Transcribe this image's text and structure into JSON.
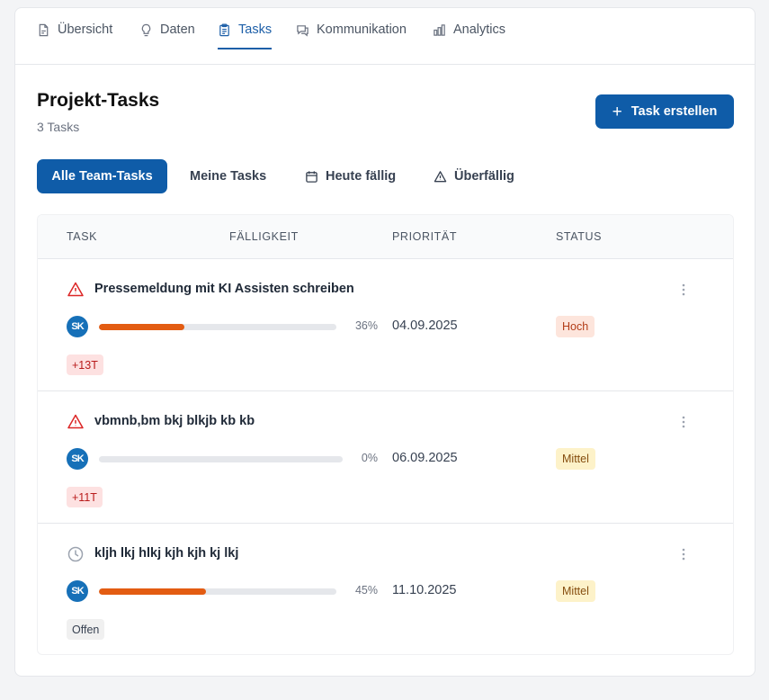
{
  "tabs": [
    {
      "label": "Übersicht",
      "icon": "document-icon"
    },
    {
      "label": "Daten",
      "icon": "lightbulb-icon"
    },
    {
      "label": "Tasks",
      "icon": "clipboard-icon",
      "active": true
    },
    {
      "label": "Kommunikation",
      "icon": "chat-icon"
    },
    {
      "label": "Analytics",
      "icon": "bar-chart-icon"
    }
  ],
  "header": {
    "title": "Projekt-Tasks",
    "count": "3 Tasks",
    "create_label": "Task erstellen"
  },
  "filters": [
    {
      "label": "Alle Team-Tasks",
      "active": true
    },
    {
      "label": "Meine Tasks"
    },
    {
      "label": "Heute fällig",
      "icon": "calendar-icon"
    },
    {
      "label": "Überfällig",
      "icon": "warning-icon"
    }
  ],
  "table": {
    "columns": [
      "TASK",
      "FÄLLIGKEIT",
      "PRIORITÄT",
      "STATUS"
    ],
    "rows": [
      {
        "title": "Pressemeldung mit KI Assisten schreiben",
        "state_icon": "warning-icon",
        "avatar": "SK",
        "progress": 36,
        "progress_label": "36%",
        "due": "04.09.2025",
        "priority": "Hoch",
        "tag": "+13T"
      },
      {
        "title": "vbmnb,bm bkj blkjb kb kb",
        "state_icon": "warning-icon",
        "avatar": "SK",
        "progress": 0,
        "progress_label": "0%",
        "due": "06.09.2025",
        "priority": "Mittel",
        "tag": "+11T"
      },
      {
        "title": "kljh lkj hlkj kjh kjh kj lkj",
        "state_icon": "clock-icon",
        "avatar": "SK",
        "progress": 45,
        "progress_label": "45%",
        "due": "11.10.2025",
        "priority": "Mittel",
        "tag": "Offen"
      }
    ]
  },
  "colors": {
    "primary": "#0f5ca8",
    "active_tab": "#1d5fa8",
    "progress": "#e35c12",
    "hoch_bg": "#fde5dc",
    "hoch_text": "#b23c17",
    "mittel_bg": "#fdf2c9",
    "mittel_text": "#854d0e",
    "overdue_bg": "#fde1e1",
    "overdue_text": "#b91c1c",
    "open_bg": "#f0f0f0",
    "open_text": "#374151"
  }
}
